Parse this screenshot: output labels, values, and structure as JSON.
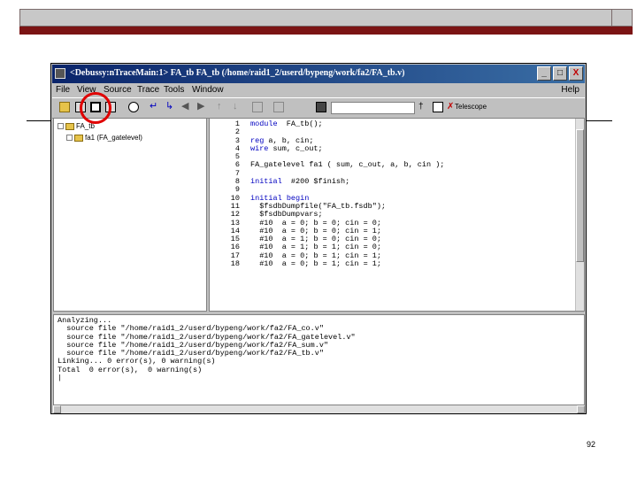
{
  "slide": {
    "page_number": "92"
  },
  "window": {
    "title": "<Debussy:nTraceMain:1> FA_tb FA_tb (/home/raid1_2/userd/bypeng/work/fa2/FA_tb.v)",
    "buttons": [
      "_",
      "□",
      "X"
    ]
  },
  "menu": {
    "items": [
      "File",
      "View",
      "Source",
      "Trace",
      "Tools",
      "Window"
    ],
    "help": "Help"
  },
  "toolbar": {
    "combo_value": "",
    "label": "Telescope"
  },
  "tree": {
    "items": [
      "FA_tb",
      "fa1 (FA_gatelevel)"
    ]
  },
  "source": {
    "line_numbers": [
      "1",
      "2",
      "3",
      "4",
      "5",
      "6",
      "7",
      "8",
      "9",
      "10",
      "11",
      "12",
      "13",
      "14",
      "15",
      "16",
      "17",
      "18"
    ],
    "lines": [
      "module  FA_tb();",
      "",
      "reg a, b, cin;",
      "wire sum, c_out;",
      "",
      "FA_gatelevel fa1 ( sum, c_out, a, b, cin );",
      "",
      "initial  #200 $finish;",
      "",
      "initial begin",
      "  $fsdbDumpfile(\"FA_tb.fsdb\");",
      "  $fsdbDumpvars;",
      "  #10  a = 0; b = 0; cin = 0;",
      "  #10  a = 0; b = 0; cin = 1;",
      "  #10  a = 1; b = 0; cin = 0;",
      "  #10  a = 1; b = 1; cin = 0;",
      "  #10  a = 0; b = 1; cin = 1;",
      "  #10  a = 0; b = 1; cin = 1;"
    ]
  },
  "log": {
    "lines": [
      "Analyzing...",
      "  source file \"/home/raid1_2/userd/bypeng/work/fa2/FA_co.v\"",
      "  source file \"/home/raid1_2/userd/bypeng/work/fa2/FA_gatelevel.v\"",
      "  source file \"/home/raid1_2/userd/bypeng/work/fa2/FA_sum.v\"",
      "  source file \"/home/raid1_2/userd/bypeng/work/fa2/FA_tb.v\"",
      "Linking... 0 error(s), 0 warning(s)",
      "Total  0 error(s),  0 warning(s)",
      "|"
    ]
  },
  "colors": {
    "title_bar": "#0a246a",
    "keyword": "#0000c0",
    "highlight_circle": "#e00000",
    "slide_rule": "#7b1414"
  }
}
